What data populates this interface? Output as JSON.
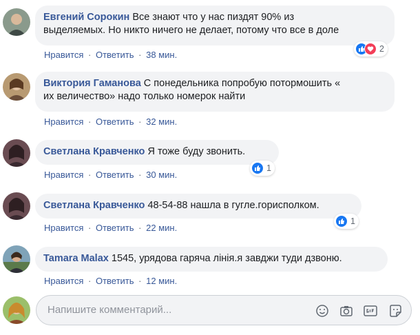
{
  "actions": {
    "like": "Нравится",
    "reply": "Ответить",
    "sep": "·"
  },
  "comments": [
    {
      "author": "Евгений Сорокин",
      "text_line1": "Все знают что у нас пиздят 90% из",
      "text_line2": "выделяемых. Но никто ничего не делает, потому что все в доле",
      "time": "38 мин.",
      "reactions": [
        "like-icon",
        "love-icon"
      ],
      "reaction_count": "2"
    },
    {
      "author": "Виктория Гаманова",
      "text_line1": "С понедельника попробую потормошить «",
      "text_line2": "их величество» надо только номерок найти",
      "time": "32 мин."
    },
    {
      "author": "Светлана Кравченко",
      "text_line1": "Я тоже буду звонить.",
      "time": "30 мин.",
      "reactions": [
        "like-icon"
      ],
      "reaction_count": "1"
    },
    {
      "author": "Светлана Кравченко",
      "text_line1": "48-54-88 нашла в гугле.горисполком.",
      "time": "22 мин.",
      "reactions": [
        "like-icon"
      ],
      "reaction_count": "1"
    },
    {
      "author": "Tamara Malax",
      "text_line1": "1545, урядова гаряча лінія.я завджи туди дзвоню.",
      "time": "12 мин."
    }
  ],
  "composer": {
    "placeholder": "Напишите комментарий...",
    "tools": [
      "emoji-icon",
      "camera-icon",
      "gif-icon",
      "sticker-icon"
    ]
  },
  "colors": {
    "link": "#385898",
    "bubble": "#f2f3f5",
    "like": "#1877f2",
    "love": "#f33e58"
  }
}
